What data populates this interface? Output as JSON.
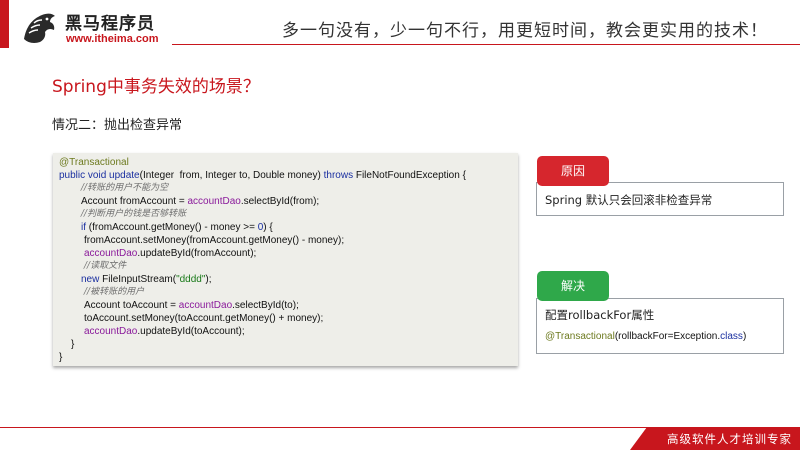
{
  "header": {
    "brand": "黑马程序员",
    "site": "www.itheima.com",
    "slogan": "多一句没有，少一句不行，用更短时间，教会更实用的技术！"
  },
  "slide": {
    "title": "Spring中事务失效的场景？",
    "subtitle": "情况二：抛出检查异常"
  },
  "code": {
    "l1": "@Transactional",
    "l2": {
      "a": "public void ",
      "b": "update",
      "c": "(Integer  from, Integer to, Double money) ",
      "d": "throws",
      "e": " FileNotFoundException {"
    },
    "l3": "//转账的用户不能为空",
    "l4": {
      "a": "Account fromAccount = ",
      "b": "accountDao",
      "c": ".selectById(from);"
    },
    "l5": "//判断用户的钱是否够转账",
    "l6": {
      "a": "if",
      "b": " (fromAccount.getMoney() - money >= ",
      "c": "0",
      "d": ") {"
    },
    "l7": "fromAccount.setMoney(fromAccount.getMoney() - money);",
    "l8": {
      "a": "accountDao",
      "b": ".updateById(fromAccount);"
    },
    "l9": "//读取文件",
    "l10": {
      "a": "new",
      "b": " FileInputStream(",
      "c": "\"dddd\"",
      "d": ");"
    },
    "l11": "//被转账的用户",
    "l12": {
      "a": "Account toAccount = ",
      "b": "accountDao",
      "c": ".selectById(to);"
    },
    "l13": "toAccount.setMoney(toAccount.getMoney() + money);",
    "l14": {
      "a": "accountDao",
      "b": ".updateById(toAccount);"
    },
    "l15": "}",
    "l16": "}"
  },
  "cause": {
    "label": "原因",
    "text": "Spring 默认只会回滚非检查异常"
  },
  "solution": {
    "label": "解决",
    "text": "配置rollbackFor属性",
    "code": {
      "a": "@Transactional",
      "b": "(rollbackFor=Exception.",
      "c": "class",
      "d": ")"
    }
  },
  "footer": {
    "slogan": "高级软件人才培训专家"
  },
  "colors": {
    "brand_red": "#c8161d",
    "tag_green": "#2fa84a",
    "code_bg": "#eeeee9"
  }
}
